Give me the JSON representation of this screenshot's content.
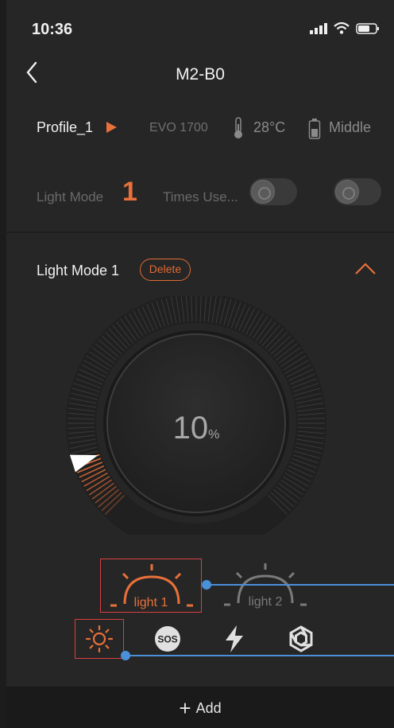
{
  "status": {
    "time": "10:36"
  },
  "nav": {
    "title": "M2-B0"
  },
  "info": {
    "profile": "Profile_1",
    "model": "EVO 1700",
    "temperature": "28°C",
    "battery": "Middle"
  },
  "mode_row": {
    "label": "Light Mode",
    "number": "1",
    "times_label": "Times Use..."
  },
  "panel": {
    "title": "Light Mode 1",
    "delete_label": "Delete",
    "intensity_value": "10",
    "intensity_unit": "%",
    "intensity_fraction": 0.1
  },
  "lights": [
    {
      "label": "light 1",
      "selected": true
    },
    {
      "label": "light 2",
      "selected": false
    }
  ],
  "tabs": [
    {
      "icon": "sun-icon",
      "selected": true
    },
    {
      "icon": "sos-icon",
      "text": "SOS"
    },
    {
      "icon": "flash-icon"
    },
    {
      "icon": "hexagon-icon"
    }
  ],
  "bottom": {
    "add_label": "Add"
  },
  "colors": {
    "accent": "#e8703a",
    "annotation": "#4a90d9",
    "highlight_box": "#d94040"
  }
}
